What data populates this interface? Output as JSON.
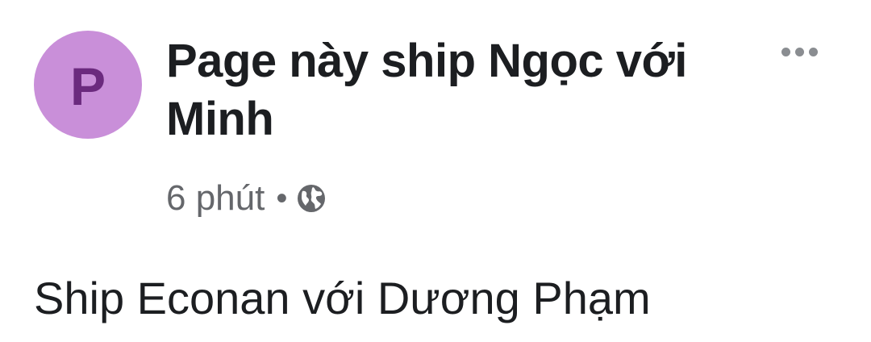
{
  "post": {
    "avatar_letter": "P",
    "page_name": "Page này ship Ngọc với Minh",
    "timestamp": "6 phút",
    "separator": "•",
    "privacy_icon": "globe-icon",
    "more_icon": "more-dots-icon",
    "body_text": "Ship Econan với Dương Phạm"
  },
  "colors": {
    "avatar_bg": "#c98fd9",
    "avatar_letter": "#6b2a7e",
    "meta_text": "#65676b"
  }
}
